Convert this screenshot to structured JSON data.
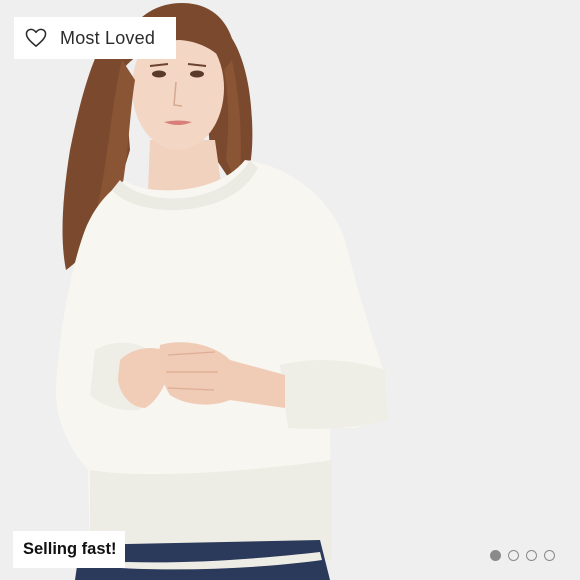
{
  "product_card": {
    "badge_top": {
      "label": "Most Loved",
      "icon": "heart-outline-icon"
    },
    "badge_bottom": {
      "label": "Selling fast!"
    },
    "image": {
      "alt": "Model wearing a cream oversized crew-neck sweater with jeans"
    },
    "carousel": {
      "total": 4,
      "active": 1
    }
  },
  "colors": {
    "background": "#efefef",
    "badge_bg": "#ffffff",
    "dot": "#8a8a8a"
  }
}
